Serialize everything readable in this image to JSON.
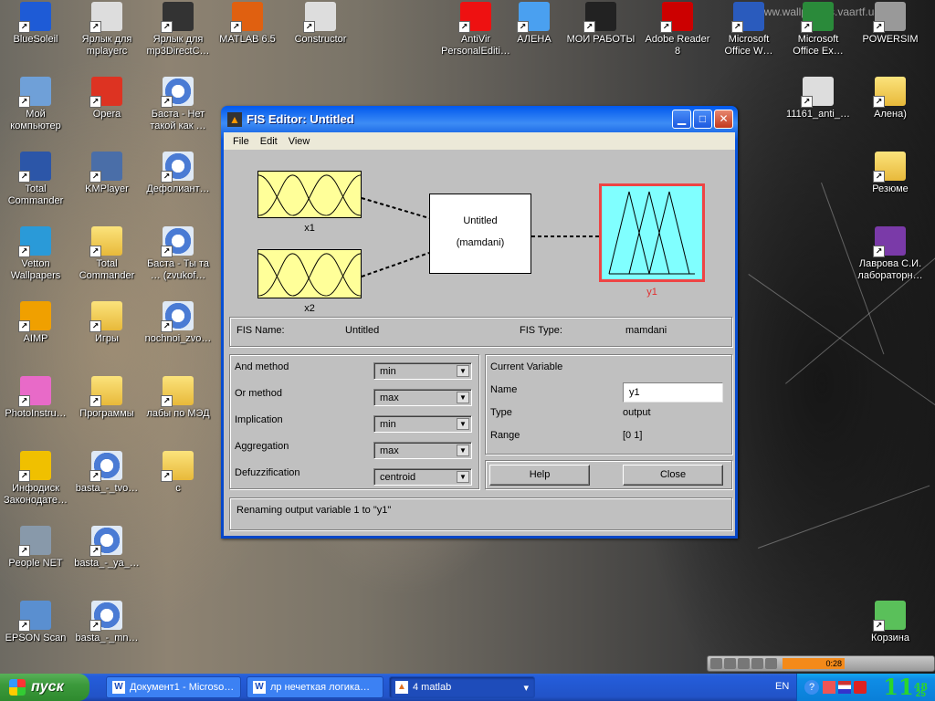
{
  "desktop": {
    "col1": [
      {
        "label": "BlueSoleil",
        "icon": "bluetooth-icon"
      },
      {
        "label": "Мой\nкомпьютер",
        "icon": "my-computer-icon"
      },
      {
        "label": "Total\nCommander",
        "icon": "floppy-icon"
      },
      {
        "label": "Vetton\nWallpapers",
        "icon": "wallpapers-icon"
      },
      {
        "label": "AIMP",
        "icon": "aimp-icon"
      },
      {
        "label": "PhotoInstru…",
        "icon": "photoinstruments-icon"
      },
      {
        "label": "Инфодиск\nЗаконодате…",
        "icon": "infodisk-icon"
      },
      {
        "label": "People NET",
        "icon": "people-net-icon"
      },
      {
        "label": "EPSON Scan",
        "icon": "epson-scan-icon"
      }
    ],
    "col2": [
      {
        "label": "Ярлык для\nmplayerc",
        "icon": "mplayer-icon"
      },
      {
        "label": "Opera",
        "icon": "opera-icon"
      },
      {
        "label": "KMPlayer",
        "icon": "kmplayer-icon"
      },
      {
        "label": "Total\nCommander",
        "icon": "folder-icon"
      },
      {
        "label": "Игры",
        "icon": "folder-icon"
      },
      {
        "label": "Программы",
        "icon": "folder-icon"
      },
      {
        "label": "basta_-_tvo…",
        "icon": "media-file-icon"
      },
      {
        "label": "basta_-_ya_…",
        "icon": "media-file-icon"
      },
      {
        "label": "basta_-_mn…",
        "icon": "media-file-icon"
      }
    ],
    "col3": [
      {
        "label": "Ярлык для\nmp3DirectC…",
        "icon": "mp3directcut-icon"
      },
      {
        "label": "Баста - Нет\nтакой как …",
        "icon": "media-file-icon"
      },
      {
        "label": "Дефолиант…",
        "icon": "media-file-icon"
      },
      {
        "label": "Баста - Ты та\n… (zvukof…",
        "icon": "media-file-icon"
      },
      {
        "label": "nochnoi_zvo…",
        "icon": "media-file-icon"
      },
      {
        "label": "лабы по МЭД",
        "icon": "folder-icon"
      },
      {
        "label": "c",
        "icon": "folder-icon"
      }
    ],
    "toprow": [
      {
        "label": "MATLAB 6.5",
        "icon": "matlab-icon"
      },
      {
        "label": "Constructor",
        "icon": "constructor-icon"
      },
      {
        "label": "AntiVir\nPersonalEditi…",
        "icon": "antivir-icon"
      },
      {
        "label": "АЛЕНА",
        "icon": "windows-icon"
      },
      {
        "label": "МОИ РАБОТЫ",
        "icon": "my-works-icon"
      },
      {
        "label": "Adobe Reader\n8",
        "icon": "adobe-reader-icon"
      },
      {
        "label": "Microsoft\nOffice W…",
        "icon": "word-icon"
      },
      {
        "label": "Microsoft\nOffice Ex…",
        "icon": "excel-icon"
      },
      {
        "label": "POWERSIM",
        "icon": "powersim-icon"
      }
    ],
    "right": [
      {
        "label": "11161_anti_…",
        "icon": "quicktime-icon"
      },
      {
        "label": "Алена)",
        "icon": "folder-icon"
      },
      {
        "label": "Резюме",
        "icon": "folder-icon"
      },
      {
        "label": "Лаврова С.И.\nлабораторн…",
        "icon": "winrar-icon"
      },
      {
        "label": "Корзина",
        "icon": "recycle-bin-icon"
      }
    ],
    "watermark": "www.wallpapers.vaartf.ua"
  },
  "window": {
    "title": "FIS Editor: Untitled",
    "menu": [
      "File",
      "Edit",
      "View"
    ],
    "diagram": {
      "input1": "x1",
      "input2": "x2",
      "rule_name": "Untitled",
      "rule_type": "(mamdani)",
      "output": "y1"
    },
    "fis_name_label": "FIS Name:",
    "fis_name": "Untitled",
    "fis_type_label": "FIS Type:",
    "fis_type": "mamdani",
    "methods": [
      {
        "label": "And method",
        "value": "min"
      },
      {
        "label": "Or method",
        "value": "max"
      },
      {
        "label": "Implication",
        "value": "min"
      },
      {
        "label": "Aggregation",
        "value": "max"
      },
      {
        "label": "Defuzzification",
        "value": "centroid"
      }
    ],
    "current_variable": {
      "heading": "Current Variable",
      "name_label": "Name",
      "name_value": "y1",
      "type_label": "Type",
      "type_value": "output",
      "range_label": "Range",
      "range_value": "[0 1]"
    },
    "help_button": "Help",
    "close_button": "Close",
    "status": "Renaming output variable 1 to \"y1\""
  },
  "taskbar": {
    "start": "пуск",
    "tasks": [
      {
        "label": "Документ1 - Microso…",
        "icon": "W"
      },
      {
        "label": "лр нечеткая логика…",
        "icon": "W"
      },
      {
        "label": "4 matlab",
        "icon": "M"
      }
    ],
    "lang": "EN",
    "clock_hour": "11",
    "clock_min": "48",
    "clock_sec": "25",
    "player_time": "0:28"
  }
}
